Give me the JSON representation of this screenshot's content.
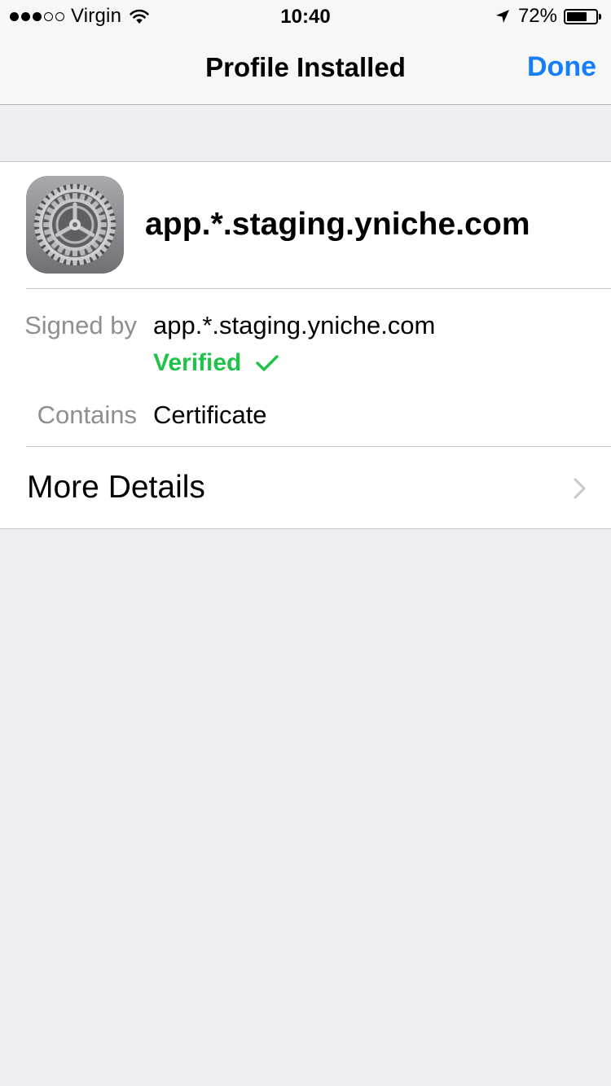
{
  "status_bar": {
    "carrier": "Virgin",
    "signal_bars_filled": 3,
    "signal_bars_total": 5,
    "time": "10:40",
    "battery_percent_text": "72%",
    "battery_level": 0.72,
    "icons": [
      "wifi-icon",
      "location-arrow-icon",
      "battery-icon"
    ]
  },
  "nav": {
    "title": "Profile Installed",
    "done_label": "Done",
    "accent_color": "#147efb"
  },
  "profile": {
    "name": "app.*.staging.yniche.com",
    "icon": "settings-gear-icon",
    "signed_by_label": "Signed by",
    "signed_by_value": "app.*.staging.yniche.com",
    "verified_label": "Verified",
    "verified_color": "#1fc34a",
    "contains_label": "Contains",
    "contains_value": "Certificate"
  },
  "more_details": {
    "label": "More Details"
  }
}
